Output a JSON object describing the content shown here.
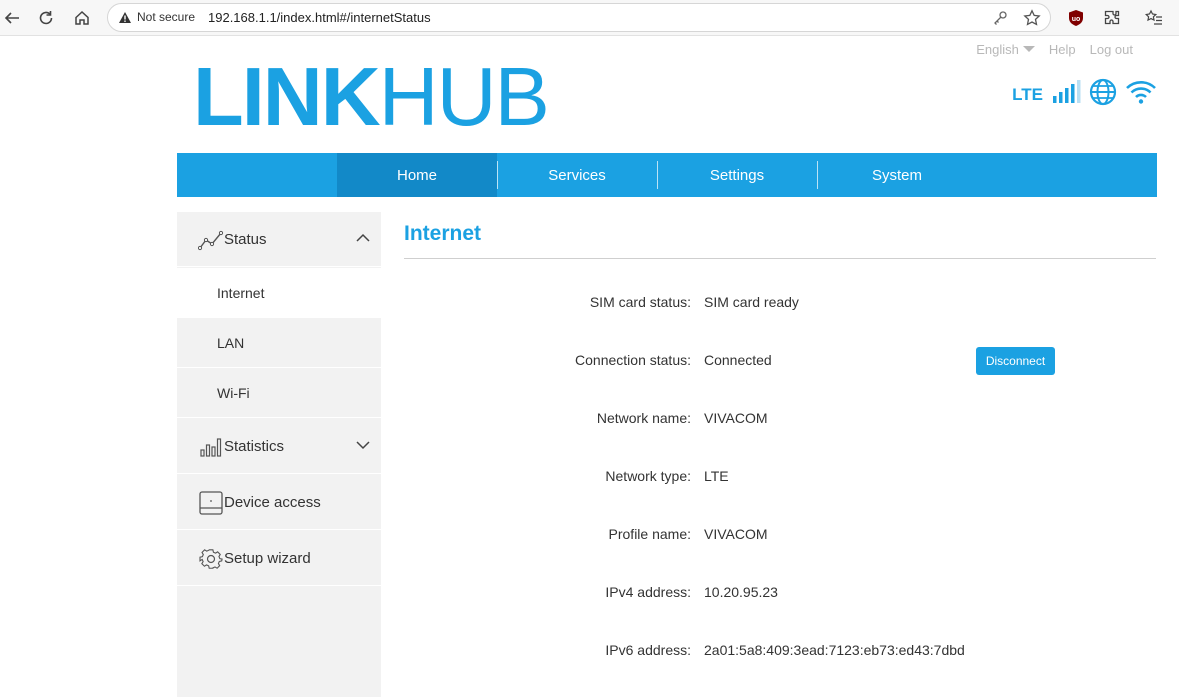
{
  "browser": {
    "security_label": "Not secure",
    "url": "192.168.1.1/index.html#/internetStatus"
  },
  "top_links": {
    "language": "English",
    "help": "Help",
    "logout": "Log out"
  },
  "logo": {
    "part1": "LINK",
    "part2": "HUB"
  },
  "status": {
    "network_type": "LTE"
  },
  "nav": {
    "items": [
      {
        "label": "Home"
      },
      {
        "label": "Services"
      },
      {
        "label": "Settings"
      },
      {
        "label": "System"
      }
    ]
  },
  "sidebar": {
    "groups": [
      {
        "label": "Status",
        "icon": "line-chart-icon"
      },
      {
        "label": "Statistics",
        "icon": "bar-chart-icon"
      },
      {
        "label": "Device access",
        "icon": "device-icon"
      },
      {
        "label": "Setup wizard",
        "icon": "gear-icon"
      }
    ],
    "status_items": [
      {
        "label": "Internet"
      },
      {
        "label": "LAN"
      },
      {
        "label": "Wi-Fi"
      }
    ]
  },
  "content": {
    "title": "Internet",
    "rows": [
      {
        "label": "SIM card status:",
        "value": "SIM card ready"
      },
      {
        "label": "Connection status:",
        "value": "Connected"
      },
      {
        "label": "Network name:",
        "value": "VIVACOM"
      },
      {
        "label": "Network type:",
        "value": "LTE"
      },
      {
        "label": "Profile name:",
        "value": "VIVACOM"
      },
      {
        "label": "IPv4 address:",
        "value": "10.20.95.23"
      },
      {
        "label": "IPv6 address:",
        "value": "2a01:5a8:409:3ead:7123:eb73:ed43:7dbd"
      }
    ],
    "disconnect_label": "Disconnect"
  },
  "colors": {
    "accent": "#1ba1e2",
    "nav_active": "#1289c8",
    "sidebar_bg": "#f2f2f2"
  }
}
